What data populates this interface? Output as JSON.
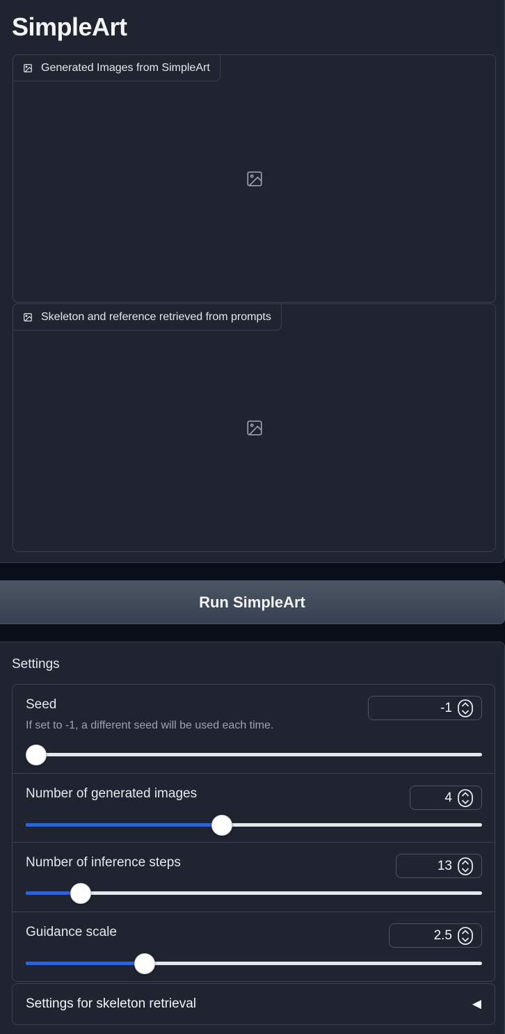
{
  "app": {
    "title": "SimpleArt"
  },
  "galleries": [
    {
      "label": "Generated Images from SimpleArt"
    },
    {
      "label": "Skeleton and reference retrieved from prompts"
    }
  ],
  "run_button": {
    "label": "Run SimpleArt"
  },
  "settings": {
    "title": "Settings",
    "seed": {
      "label": "Seed",
      "info": "If set to -1, a different seed will be used each time.",
      "value": "-1",
      "fraction": 0.0
    },
    "num_images": {
      "label": "Number of generated images",
      "value": "4",
      "fraction": 0.43
    },
    "num_steps": {
      "label": "Number of inference steps",
      "value": "13",
      "fraction": 0.12
    },
    "guidance": {
      "label": "Guidance scale",
      "value": "2.5",
      "fraction": 0.26
    },
    "skeleton_accordion": {
      "label": "Settings for skeleton retrieval",
      "arrow": "◀"
    }
  },
  "colors": {
    "accent": "#2563eb",
    "panel": "#1f2430",
    "border": "#374151"
  }
}
